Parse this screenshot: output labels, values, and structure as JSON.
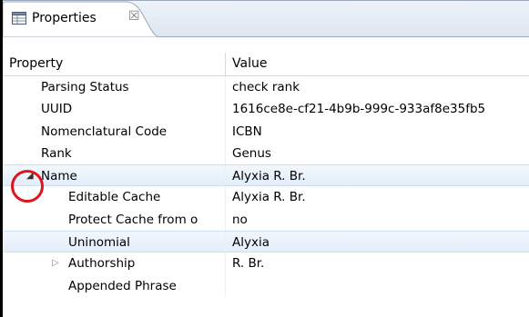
{
  "tab": {
    "label": "Properties",
    "close_glyph": "☒",
    "icon": "properties-table-icon"
  },
  "table": {
    "columns": [
      "Property",
      "Value"
    ],
    "rows": [
      {
        "property": "Parsing Status",
        "value": "check rank",
        "level": 0
      },
      {
        "property": "UUID",
        "value": "1616ce8e-cf21-4b9b-999c-933af8e35fb5",
        "level": 0
      },
      {
        "property": "Nomenclatural Code",
        "value": "ICBN",
        "level": 0
      },
      {
        "property": "Rank",
        "value": "Genus",
        "level": 0
      },
      {
        "property": "Name",
        "value": "Alyxia R. Br.",
        "level": 0,
        "expander": "◢",
        "expanded": true,
        "selected": true
      },
      {
        "property": "Editable Cache",
        "value": "Alyxia R. Br.",
        "level": 1
      },
      {
        "property": "Protect Cache from o",
        "value": "no",
        "level": 1
      },
      {
        "property": "Uninomial",
        "value": "Alyxia",
        "level": 1,
        "selected": true
      },
      {
        "property": "Authorship",
        "value": "R. Br.",
        "level": 1,
        "expander": "▷",
        "expanded": false
      },
      {
        "property": "Appended Phrase",
        "value": "",
        "level": 1
      }
    ]
  },
  "annotation_color": "#e0141b"
}
